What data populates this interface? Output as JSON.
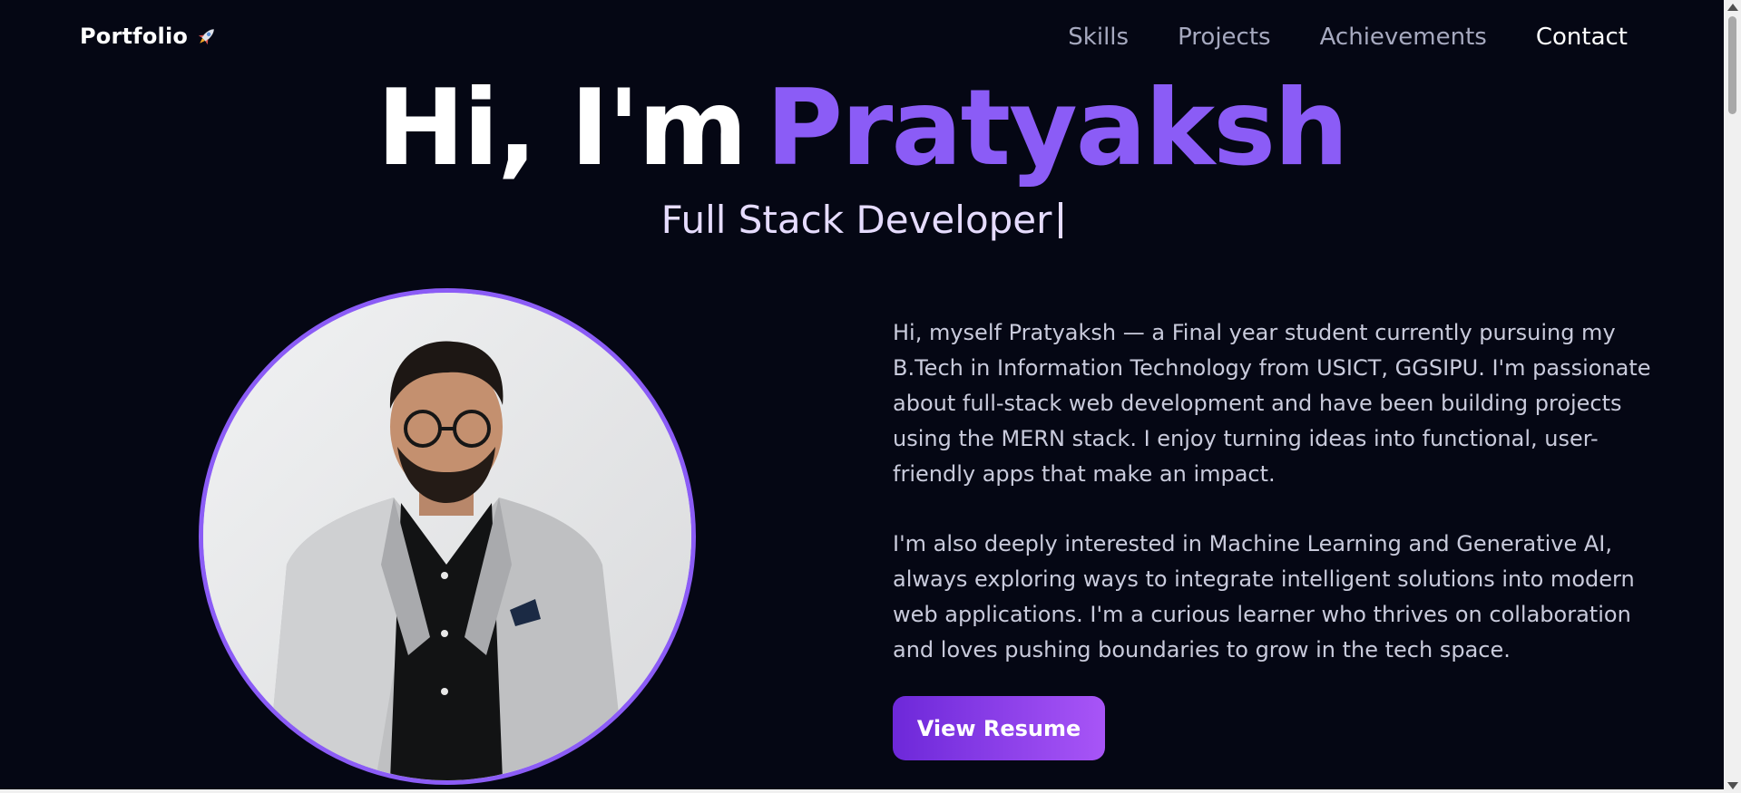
{
  "nav": {
    "brand": "Portfolio",
    "brand_icon": "rocket-icon",
    "links": [
      {
        "label": "Skills"
      },
      {
        "label": "Projects"
      },
      {
        "label": "Achievements"
      },
      {
        "label": "Contact"
      }
    ],
    "active_link": "Contact"
  },
  "hero": {
    "greeting": "Hi, I'm",
    "name": "Pratyaksh",
    "role": "Full Stack Developer"
  },
  "about": {
    "paragraph_1": "Hi, myself Pratyaksh — a Final year student currently pursuing my B.Tech in Information Technology from USICT, GGSIPU. I'm passionate about full-stack web development and have been building projects using the MERN stack. I enjoy turning ideas into functional, user-friendly apps that make an impact.",
    "paragraph_2": "I'm also deeply interested in Machine Learning and Generative AI, always exploring ways to integrate intelligent solutions into modern web applications. I'm a curious learner who thrives on collaboration and loves pushing boundaries to grow in the tech space.",
    "resume_button": "View Resume"
  },
  "colors": {
    "background": "#050714",
    "accent": "#8b5cf6",
    "nav_text": "#a6a9bf",
    "body_text": "#c9cbdc",
    "button_gradient_start": "#6d28d9",
    "button_gradient_end": "#a855f7"
  }
}
